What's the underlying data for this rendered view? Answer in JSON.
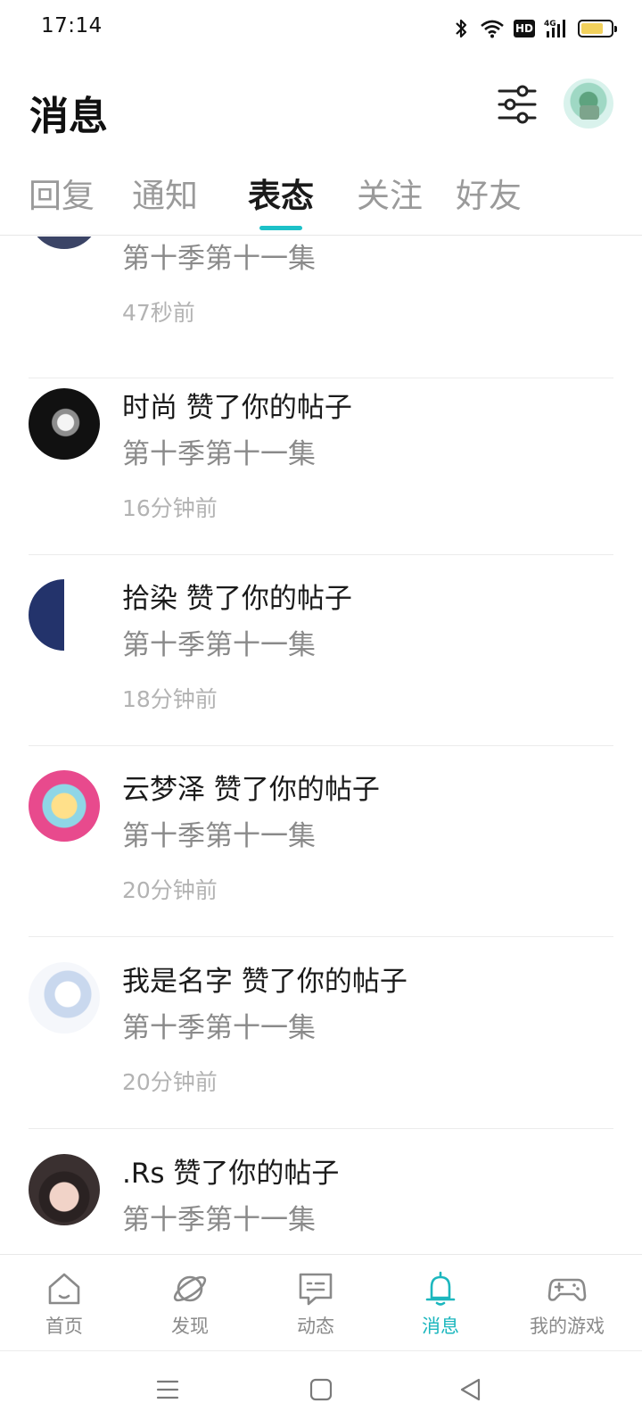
{
  "status_bar": {
    "time": "17:14",
    "hd_label": "HD",
    "network_label": "4G",
    "battery_level": 0.75,
    "battery_color": "#f2d15c"
  },
  "header": {
    "title": "消息"
  },
  "tabs": [
    {
      "label": "回复",
      "active": false
    },
    {
      "label": "通知",
      "active": false
    },
    {
      "label": "表态",
      "active": true
    },
    {
      "label": "关注",
      "active": false
    },
    {
      "label": "好友",
      "active": false
    }
  ],
  "accent_color": "#1cc1c8",
  "notifications": [
    {
      "title": "",
      "subtitle": "第十季第十一集",
      "time": "47秒前"
    },
    {
      "title": "时尚 赞了你的帖子",
      "subtitle": "第十季第十一集",
      "time": "16分钟前"
    },
    {
      "title": "拾染 赞了你的帖子",
      "subtitle": "第十季第十一集",
      "time": "18分钟前"
    },
    {
      "title": "云梦泽 赞了你的帖子",
      "subtitle": "第十季第十一集",
      "time": "20分钟前"
    },
    {
      "title": "我是名字 赞了你的帖子",
      "subtitle": "第十季第十一集",
      "time": "20分钟前"
    },
    {
      "title": ".Rs 赞了你的帖子",
      "subtitle": "第十季第十一集",
      "time": ""
    }
  ],
  "bottom_nav": [
    {
      "label": "首页",
      "icon": "home-icon",
      "active": false
    },
    {
      "label": "发现",
      "icon": "planet-icon",
      "active": false
    },
    {
      "label": "动态",
      "icon": "chat-icon",
      "active": false
    },
    {
      "label": "消息",
      "icon": "bell-icon",
      "active": true
    },
    {
      "label": "我的游戏",
      "icon": "gamepad-icon",
      "active": false
    }
  ],
  "system_nav": [
    "menu-icon",
    "home-square-icon",
    "back-triangle-icon"
  ]
}
